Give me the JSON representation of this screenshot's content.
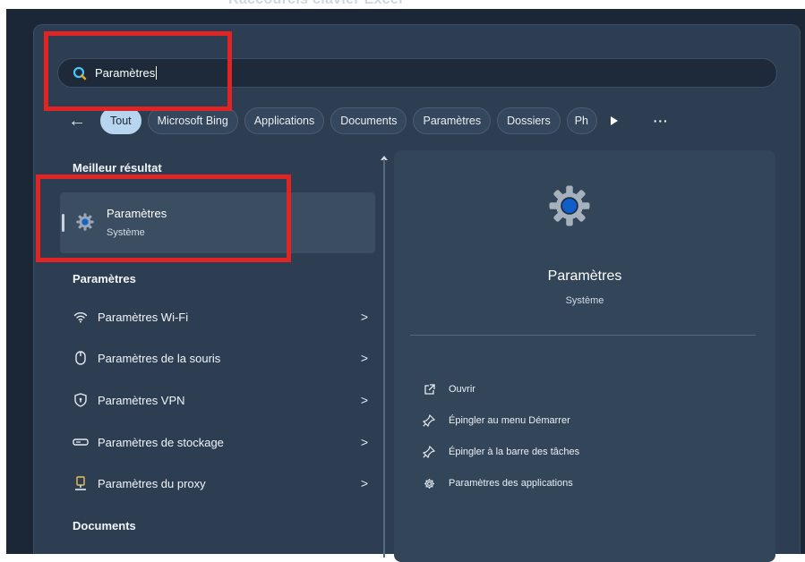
{
  "top_cut_text": "Raccourcis clavier Excel",
  "search": {
    "value": "Paramètres"
  },
  "filters": {
    "back_label": "←",
    "pills": [
      "Tout",
      "Microsoft Bing",
      "Applications",
      "Documents",
      "Paramètres",
      "Dossiers",
      "Ph"
    ],
    "more_label": "···"
  },
  "left": {
    "best_section": "Meilleur résultat",
    "best": {
      "title": "Paramètres",
      "subtitle": "Système"
    },
    "settings_section": "Paramètres",
    "settings_items": [
      {
        "label": "Paramètres Wi-Fi",
        "icon": "wifi-icon",
        "chevron": ">"
      },
      {
        "label": "Paramètres de la souris",
        "icon": "mouse-icon",
        "chevron": ">"
      },
      {
        "label": "Paramètres VPN",
        "icon": "shield-icon",
        "chevron": ">"
      },
      {
        "label": "Paramètres de stockage",
        "icon": "storage-icon",
        "chevron": ">"
      },
      {
        "label": "Paramètres du proxy",
        "icon": "proxy-icon",
        "chevron": ">"
      }
    ],
    "documents_section": "Documents"
  },
  "right": {
    "title": "Paramètres",
    "subtitle": "Système",
    "actions": [
      {
        "label": "Ouvrir",
        "icon": "open-external-icon"
      },
      {
        "label": "Épingler au menu Démarrer",
        "icon": "pin-icon"
      },
      {
        "label": "Épingler à la barre des tâches",
        "icon": "pin-icon"
      },
      {
        "label": "Paramètres des applications",
        "icon": "gear-icon"
      }
    ]
  },
  "colors": {
    "background": "#1b2636",
    "panel": "#2d3e52",
    "active_pill": "#b7d5ee",
    "annotation_red": "#e02424",
    "gear_center": "#0f5fc8"
  }
}
